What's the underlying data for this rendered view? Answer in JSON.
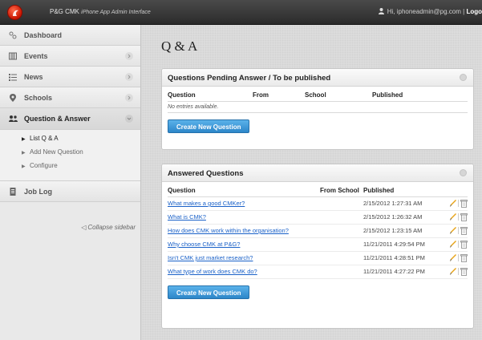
{
  "app": {
    "brand": "P&G CMK",
    "subtitle": "iPhone App Admin Interface",
    "user_greeting": "Hi, iphoneadmin@pg.com",
    "separator": "|",
    "logout_label": "Logo"
  },
  "sidebar": {
    "items": [
      {
        "label": "Dashboard",
        "icon": "dashboard-icon"
      },
      {
        "label": "Events",
        "icon": "calendar-icon"
      },
      {
        "label": "News",
        "icon": "list-icon"
      },
      {
        "label": "Schools",
        "icon": "location-pin-icon"
      },
      {
        "label": "Question & Answer",
        "icon": "people-icon"
      },
      {
        "label": "Job Log",
        "icon": "document-icon"
      }
    ],
    "subitems": [
      {
        "label": "List Q & A"
      },
      {
        "label": "Add New Question"
      },
      {
        "label": "Configure"
      }
    ],
    "collapse_label": "Collapse sidebar"
  },
  "main": {
    "title": "Q & A",
    "pending": {
      "heading": "Questions Pending Answer / To be published",
      "columns": [
        "Question",
        "From",
        "School",
        "Published"
      ],
      "empty_text": "No entries available.",
      "button_label": "Create New Question"
    },
    "answered": {
      "heading": "Answered Questions",
      "columns": [
        "Question",
        "From School",
        "Published"
      ],
      "rows": [
        {
          "question": "What makes a good CMKer?",
          "published": "2/15/2012 1:27:31 AM"
        },
        {
          "question": "What is CMK?",
          "published": "2/15/2012 1:26:32 AM"
        },
        {
          "question": "How does CMK work within the organisation?",
          "published": "2/15/2012 1:23:15 AM"
        },
        {
          "question": "Why choose CMK at P&G?",
          "published": "11/21/2011 4:29:54 PM"
        },
        {
          "question": "Isn't CMK just market research?",
          "published": "11/21/2011 4:28:51 PM"
        },
        {
          "question": "What type of work does CMK do?",
          "published": "11/21/2011 4:27:22 PM"
        }
      ],
      "button_label": "Create New Question"
    }
  },
  "colors": {
    "accent": "#2c86c9",
    "link": "#1a61c8",
    "topbar": "#2b2b2b",
    "logo": "#c81400"
  }
}
